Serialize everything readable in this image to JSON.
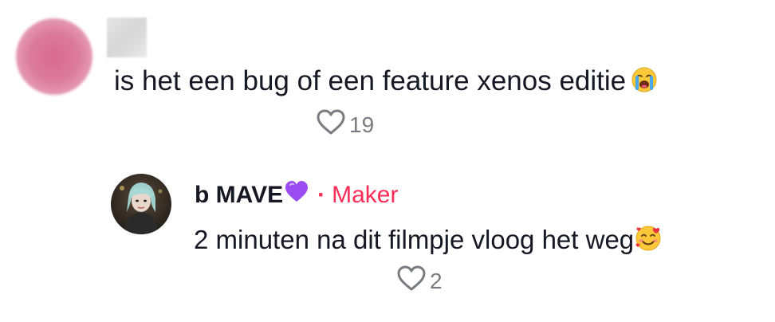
{
  "comment": {
    "text": "is het een bug of een feature xenos editie",
    "emoji": "loudly-crying-face",
    "likes": "19"
  },
  "reply": {
    "username": "b MAVE",
    "username_emoji": "purple-heart",
    "separator": "·",
    "badge": "Maker",
    "text": "2 minuten na dit filmpje vloog het weg",
    "emoji": "smiling-face-with-hearts",
    "likes": "2"
  },
  "colors": {
    "text": "#161823",
    "muted": "#7a7b80",
    "accent": "#fe2c55"
  }
}
